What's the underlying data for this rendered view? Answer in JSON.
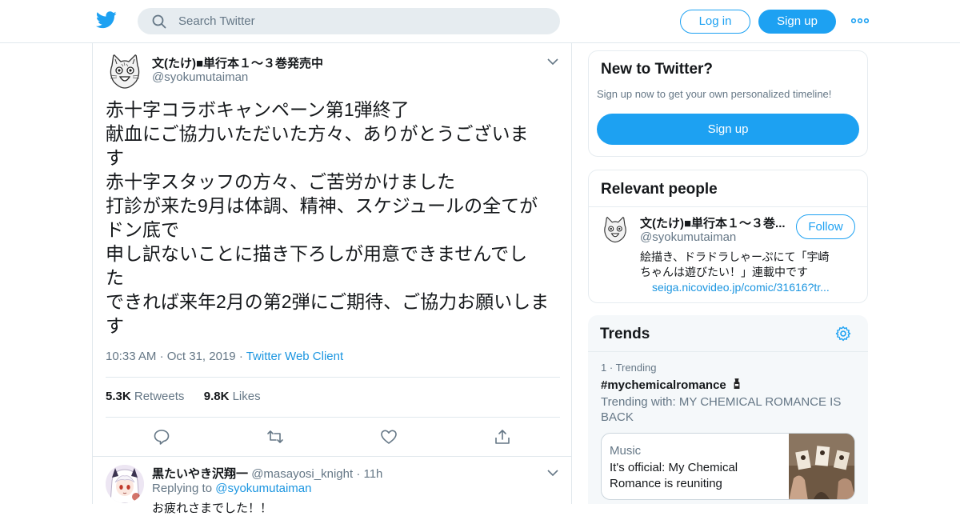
{
  "header": {
    "search_placeholder": "Search Twitter",
    "login_label": "Log in",
    "signup_label": "Sign up",
    "accent": "#1da1f2"
  },
  "tweet": {
    "author_name": "文(たけ)■単行本１～３巻発売中",
    "author_handle": "@syokumutaiman",
    "lines": [
      "赤十字コラボキャンペーン第1弾終了",
      "献血にご協力いただいた方々、ありがとうございま",
      "す",
      "赤十字スタッフの方々、ご苦労かけました",
      "打診が来た9月は体調、精神、スケジュールの全てが",
      "ドン底で",
      "申し訳ないことに描き下ろしが用意できませんでし",
      "た",
      "できれば来年2月の第2弾にご期待、ご協力お願いしま",
      "す"
    ],
    "time": "10:33 AM",
    "date": "Oct 31, 2019",
    "client": "Twitter Web Client",
    "retweet_count": "5.3K",
    "retweet_label": "Retweets",
    "like_count": "9.8K",
    "like_label": "Likes"
  },
  "reply": {
    "author_name": "黒たいやき沢翔一",
    "author_handle": "@masayosi_knight",
    "age": "11h",
    "replying_prefix": "Replying to",
    "replying_to": "@syokumutaiman",
    "text_partial": "お疲れさまでした！！"
  },
  "new_to_twitter": {
    "title": "New to Twitter?",
    "subtitle": "Sign up now to get your own personalized timeline!",
    "button": "Sign up"
  },
  "relevant_people": {
    "title": "Relevant people",
    "name": "文(たけ)■単行本１～３巻...",
    "handle": "@syokumutaiman",
    "follow": "Follow",
    "bio_line1": "絵描き、ドラドラしゃーぷにて「宇崎",
    "bio_line2": "ちゃんは遊びたい！」連載中です",
    "link": "seiga.nicovideo.jp/comic/31616?tr..."
  },
  "trends": {
    "title": "Trends",
    "rank": "1",
    "rank_label": "Trending",
    "hashtag": "#mychemicalromance",
    "with_line1": "Trending with: MY CHEMICAL ROMANCE IS",
    "with_line2": "BACK",
    "card_category": "Music",
    "card_line1": "It's official: My Chemical",
    "card_line2": "Romance is reuniting"
  }
}
